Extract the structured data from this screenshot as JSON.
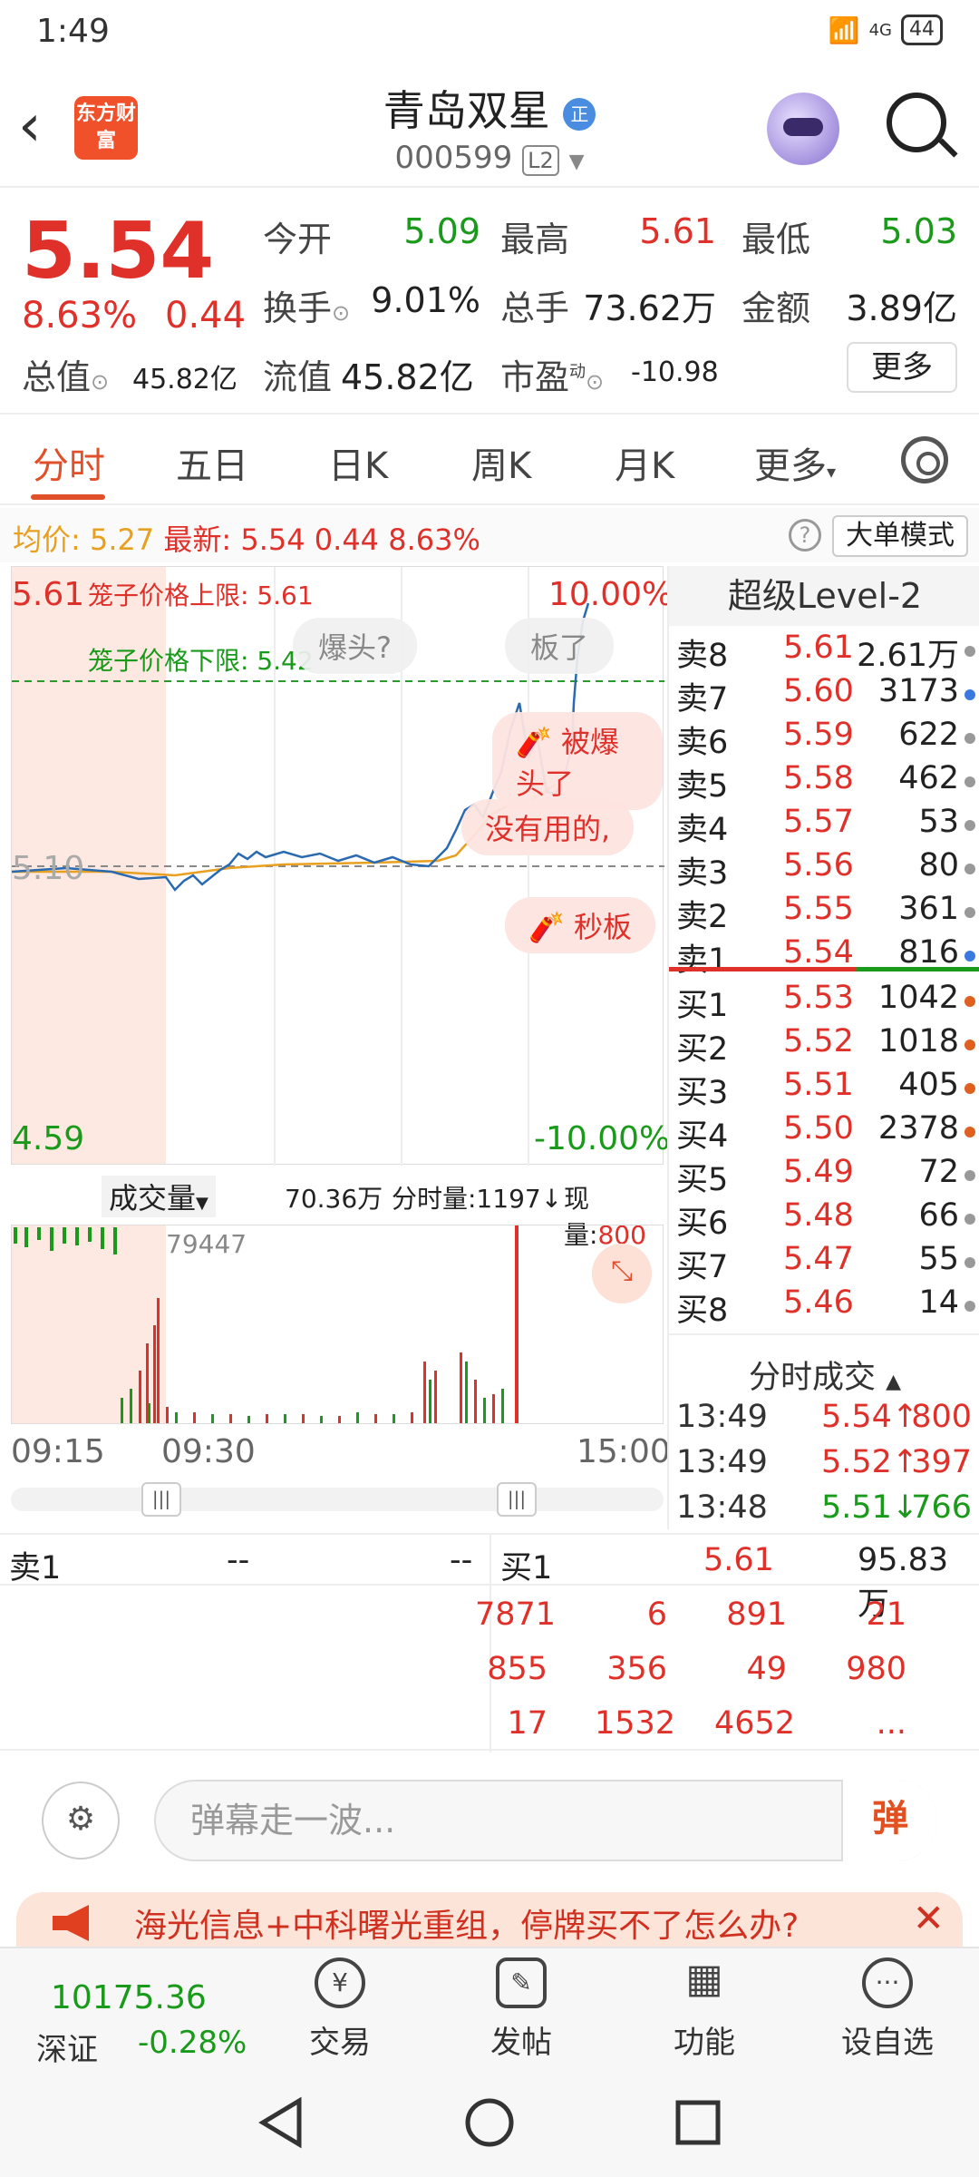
{
  "status": {
    "time": "1:49",
    "signal": "4G",
    "battery": "44"
  },
  "header": {
    "stock_name": "青岛双星",
    "name_badge": "正",
    "stock_code": "000599",
    "level_badge": "L2",
    "logo_text": "东方财富"
  },
  "quote": {
    "price": "5.54",
    "change_pct": "8.63%",
    "change": "0.44",
    "open_label": "今开",
    "open": "5.09",
    "high_label": "最高",
    "high": "5.61",
    "low_label": "最低",
    "low": "5.03",
    "turnover_label": "换手",
    "turnover": "9.01%",
    "volume_label": "总手",
    "volume": "73.62万",
    "amount_label": "金额",
    "amount": "3.89亿",
    "total_cap_label": "总值",
    "total_cap": "45.82亿",
    "float_cap_label": "流值",
    "float_cap": "45.82亿",
    "pe_label": "市盈",
    "pe_sup": "动",
    "pe": "-10.98",
    "more_label": "更多"
  },
  "tabs": [
    "分时",
    "五日",
    "日K",
    "周K",
    "月K",
    "更多"
  ],
  "infoline": {
    "avg_label": "均价:",
    "avg": "5.27",
    "latest_label": "最新:",
    "latest": "5.54",
    "chg": "0.44",
    "pct": "8.63%",
    "mode_label": "大单模式",
    "help": "?"
  },
  "chart": {
    "upper_price": "5.61",
    "lower_price": "4.59",
    "mid_price": "5.10",
    "upper_pct": "10.00%",
    "lower_pct": "-10.00%",
    "cage_upper": "笼子价格上限: 5.61",
    "cage_lower": "笼子价格下限: 5.42",
    "bubbles": [
      "爆头?",
      "板了",
      "被爆头了",
      "没有用的,",
      "秒板"
    ]
  },
  "volume": {
    "label": "成交量",
    "total": "70.36万",
    "min_vol_label": "分时量:1197↓",
    "now_label": "现量:",
    "now": "800",
    "max_label": "79447"
  },
  "time_axis": [
    "09:15",
    "09:30",
    "15:00"
  ],
  "book": {
    "title": "超级Level-2",
    "asks": [
      {
        "label": "卖8",
        "price": "5.61",
        "vol": "2.61万"
      },
      {
        "label": "卖7",
        "price": "5.60",
        "vol": "3173"
      },
      {
        "label": "卖6",
        "price": "5.59",
        "vol": "622"
      },
      {
        "label": "卖5",
        "price": "5.58",
        "vol": "462"
      },
      {
        "label": "卖4",
        "price": "5.57",
        "vol": "53"
      },
      {
        "label": "卖3",
        "price": "5.56",
        "vol": "80"
      },
      {
        "label": "卖2",
        "price": "5.55",
        "vol": "361"
      },
      {
        "label": "卖1",
        "price": "5.54",
        "vol": "816"
      }
    ],
    "bids": [
      {
        "label": "买1",
        "price": "5.53",
        "vol": "1042"
      },
      {
        "label": "买2",
        "price": "5.52",
        "vol": "1018"
      },
      {
        "label": "买3",
        "price": "5.51",
        "vol": "405"
      },
      {
        "label": "买4",
        "price": "5.50",
        "vol": "2378"
      },
      {
        "label": "买5",
        "price": "5.49",
        "vol": "72"
      },
      {
        "label": "买6",
        "price": "5.48",
        "vol": "66"
      },
      {
        "label": "买7",
        "price": "5.47",
        "vol": "55"
      },
      {
        "label": "买8",
        "price": "5.46",
        "vol": "14"
      }
    ],
    "ticks_title": "分时成交",
    "ticks": [
      {
        "time": "13:49",
        "price": "5.54↑",
        "vol": "800"
      },
      {
        "time": "13:49",
        "price": "5.52↑",
        "vol": "397"
      },
      {
        "time": "13:48",
        "price": "5.51↓",
        "vol": "766"
      }
    ]
  },
  "bottom_book": {
    "sell_label": "卖1",
    "sell_price": "--",
    "sell_vol": "--",
    "buy_label": "买1",
    "buy_price": "5.61",
    "buy_vol": "95.83万",
    "queue": [
      [
        "7871",
        "6",
        "891",
        "21"
      ],
      [
        "855",
        "356",
        "49",
        "980"
      ],
      [
        "17",
        "1532",
        "4652",
        "..."
      ]
    ]
  },
  "danmu": {
    "placeholder": "弹幕走一波...",
    "btn": "弹"
  },
  "news": {
    "text": "海光信息+中科曙光重组，停牌买不了怎么办?",
    "close": "✕"
  },
  "nav": {
    "index_value": "10175.36",
    "index_name": "深证",
    "index_pct": "-0.28%",
    "items": [
      "交易",
      "发帖",
      "功能",
      "设自选"
    ]
  },
  "colors": {
    "up": "#e0302a",
    "down": "#1a9a1a",
    "avg": "#e8a020",
    "line": "#2a6ab0",
    "accent": "#e0502a"
  }
}
